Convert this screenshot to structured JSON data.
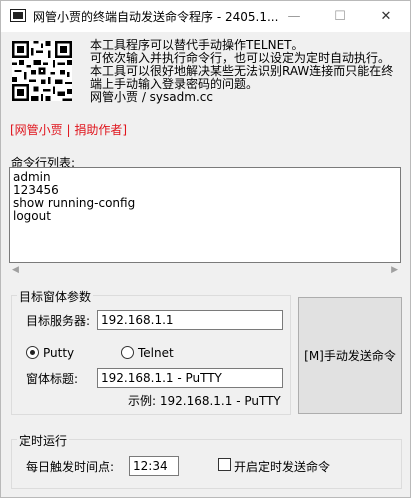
{
  "window": {
    "title": "网管小贾的终端自动发送命令程序 - 2405.1...",
    "min_glyph": "—",
    "max_glyph": "☐",
    "close_glyph": "✕"
  },
  "intro": {
    "lines": [
      "本工具程序可以替代手动操作TELNET。",
      "可依次输入并执行命令行，也可以设定为定时自动执行。",
      "本工具可以很好地解决某些无法识别RAW连接而只能在终",
      "端上手动输入登录密码的问题。",
      "网管小贾 / sysadm.cc"
    ]
  },
  "author_link": "[网管小贾 | 捐助作者]",
  "commands": {
    "label": "命令行列表:",
    "lines": [
      "admin",
      "123456",
      "show running-config",
      "logout"
    ]
  },
  "target": {
    "group_title": "目标窗体参数",
    "server_label": "目标服务器:",
    "server_value": "192.168.1.1",
    "radio_putty": "Putty",
    "radio_telnet": "Telnet",
    "selected": "Putty",
    "window_title_label": "窗体标题:",
    "window_title_value": "192.168.1.1 - PuTTY",
    "example_text": "示例: 192.168.1.1 - PuTTY"
  },
  "send_button": "[M]手动发送命令",
  "timer": {
    "group_title": "定时运行",
    "time_label": "每日触发时间点:",
    "time_value": "12:34",
    "enable_label": "开启定时发送命令",
    "enabled": false
  },
  "icons": {
    "app": "terminal-icon",
    "qr": "qr-code-icon",
    "scroll_left": "chevron-left-icon",
    "scroll_right": "chevron-right-icon"
  }
}
